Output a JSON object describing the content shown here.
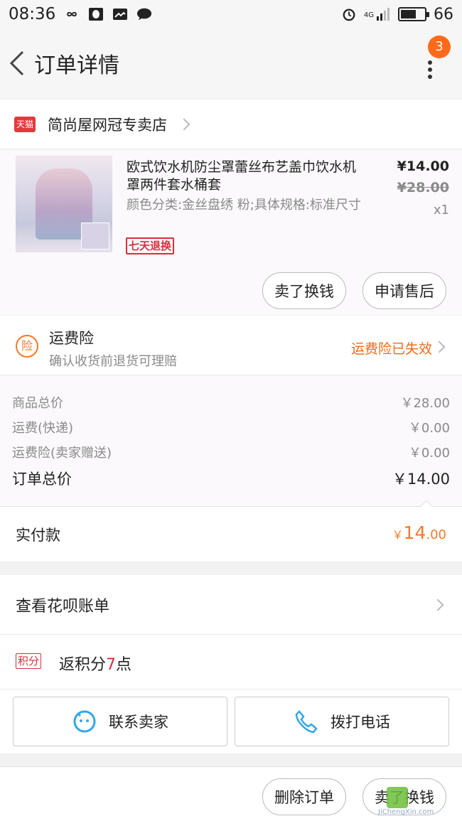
{
  "status_bar": {
    "time": "08:36",
    "network": "4G",
    "battery": "66",
    "battery_level": 0.66
  },
  "nav": {
    "title": "订单详情",
    "badge_count": "3"
  },
  "shop": {
    "platform_logo": "天猫",
    "name": "简尚屋网冠专卖店"
  },
  "product": {
    "title": "欧式饮水机防尘罩蕾丝布艺盖巾饮水机罩两件套水桶套",
    "spec": "颜色分类:金丝盘绣 粉;具体规格:标准尺寸",
    "tag": "七天退换",
    "price": "¥14.00",
    "original_price": "¥28.00",
    "quantity": "x1",
    "buttons": {
      "resell": "卖了换钱",
      "after_sale": "申请售后"
    }
  },
  "insurance": {
    "icon_label": "险",
    "title": "运费险",
    "subtitle": "确认收货前退货可理赔",
    "status": "运费险已失效"
  },
  "summary": {
    "rows": [
      {
        "label": "商品总价",
        "value": "￥28.00"
      },
      {
        "label": "运费(快递)",
        "value": "￥0.00"
      },
      {
        "label": "运费险(卖家赠送)",
        "value": "￥0.00"
      }
    ],
    "total_label": "订单总价",
    "total_value": "￥14.00"
  },
  "payment": {
    "label": "实付款",
    "symbol": "￥",
    "integer": "14",
    "decimal": ".00"
  },
  "huabei": {
    "label": "查看花呗账单"
  },
  "points": {
    "badge": "积分",
    "prefix": "返积分",
    "count": "7",
    "suffix": "点"
  },
  "contact": {
    "seller": "联系卖家",
    "phone": "拨打电话"
  },
  "bottom_bar": {
    "delete": "删除订单",
    "resell": "卖了换钱"
  },
  "watermark": {
    "text": "JiChengXin.com"
  },
  "colors": {
    "accent_orange": "#f07a2e",
    "tmall_red": "#e4393c",
    "badge_orange": "#ff6a1a"
  }
}
